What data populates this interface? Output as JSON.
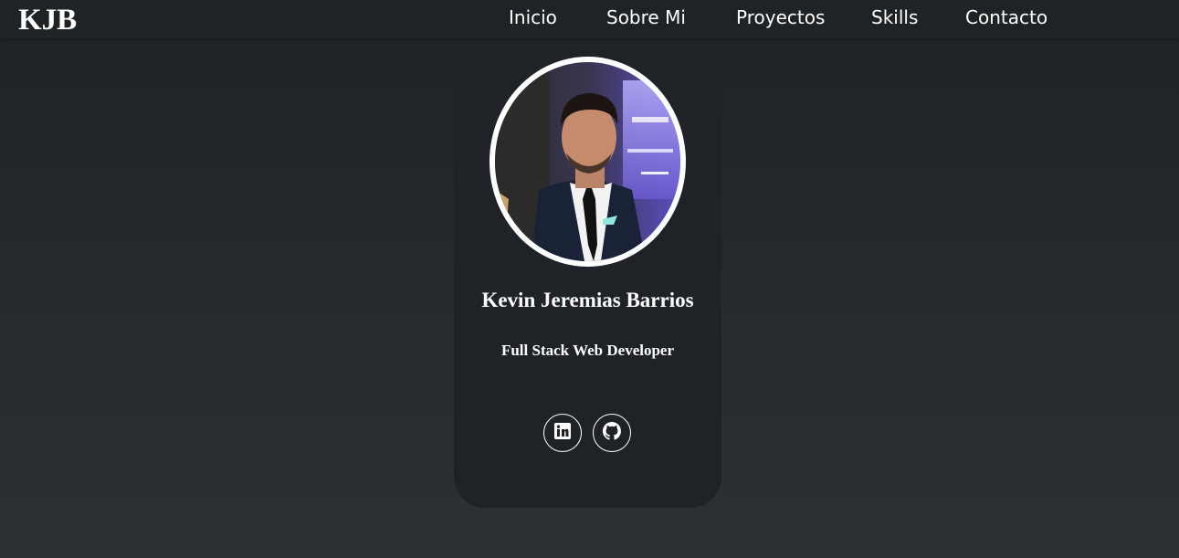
{
  "navbar": {
    "brand": "KJB",
    "links": [
      {
        "label": "Inicio"
      },
      {
        "label": "Sobre Mi"
      },
      {
        "label": "Proyectos"
      },
      {
        "label": "Skills"
      },
      {
        "label": "Contacto"
      }
    ]
  },
  "profile": {
    "name": "Kevin Jeremias Barrios",
    "role": "Full Stack Web Developer",
    "social": [
      {
        "icon": "linkedin-icon"
      },
      {
        "icon": "github-icon"
      }
    ]
  },
  "colors": {
    "background": "#25292d",
    "card": "#1f2327",
    "navbar": "#1f2326",
    "text": "#ffffff"
  }
}
